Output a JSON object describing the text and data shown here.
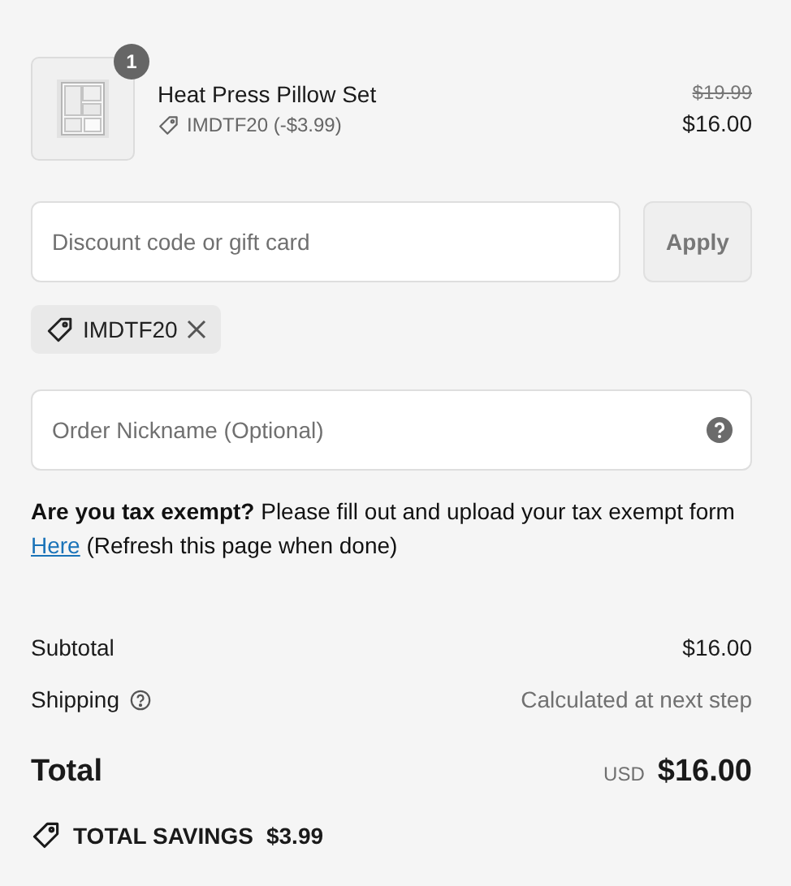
{
  "product": {
    "quantity": "1",
    "name": "Heat Press Pillow Set",
    "discount": "IMDTF20 (-$3.99)",
    "original_price": "$19.99",
    "price": "$16.00"
  },
  "discount_form": {
    "placeholder": "Discount code or gift card",
    "button": "Apply",
    "button_disabled": true
  },
  "applied_codes": [
    {
      "code": "IMDTF20"
    }
  ],
  "nickname": {
    "placeholder": "Order Nickname (Optional)"
  },
  "tax_note": {
    "text": "**Are you tax exempt?** Please fill out and upload your tax exempt form",
    "link": "Here",
    "after": "(Refresh this page when done)"
  },
  "summary": [
    {
      "kind": "line",
      "label": "Subtotal",
      "value": "$16.00"
    },
    {
      "kind": "shipping",
      "label": "Shipping",
      "value": "Calculated at next step"
    }
  ],
  "total": {
    "label": "Total",
    "currency": "USD",
    "value": "$16.00"
  },
  "savings": {
    "label": "TOTAL SAVINGS",
    "value": "$3.99"
  }
}
